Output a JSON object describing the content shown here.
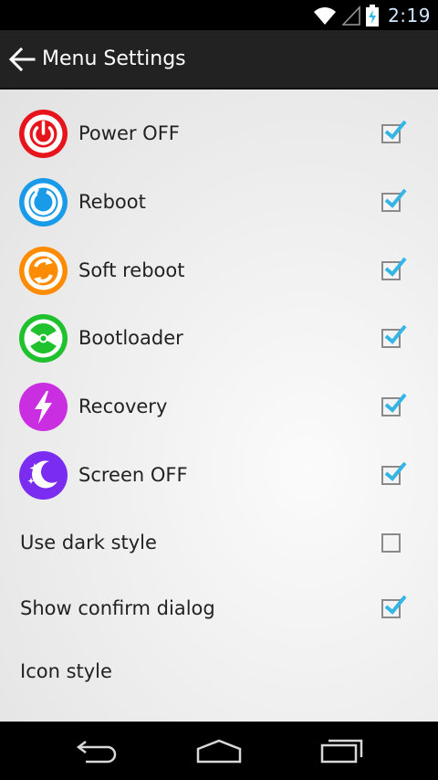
{
  "status_bar": {
    "time": "2:19"
  },
  "action_bar": {
    "title": "Menu Settings"
  },
  "menu_items": [
    {
      "label": "Power OFF",
      "checked": true,
      "color": "#e8141b",
      "icon": "power-icon"
    },
    {
      "label": "Reboot",
      "checked": true,
      "color": "#1a9bea",
      "icon": "reboot-icon"
    },
    {
      "label": "Soft reboot",
      "checked": true,
      "color": "#ff8c00",
      "icon": "soft-reboot-icon"
    },
    {
      "label": "Bootloader",
      "checked": true,
      "color": "#1fc12c",
      "icon": "bootloader-icon"
    },
    {
      "label": "Recovery",
      "checked": true,
      "color": "#c92ee0",
      "icon": "recovery-icon"
    },
    {
      "label": "Screen OFF",
      "checked": true,
      "color": "#7a2cf0",
      "icon": "screen-off-icon"
    }
  ],
  "settings": {
    "dark_style": {
      "label": "Use dark style",
      "checked": false
    },
    "confirm_dialog": {
      "label": "Show confirm dialog",
      "checked": true
    },
    "icon_style": {
      "label": "Icon style"
    }
  },
  "colors": {
    "check_accent": "#33b5e5",
    "action_bar": "#222222"
  }
}
